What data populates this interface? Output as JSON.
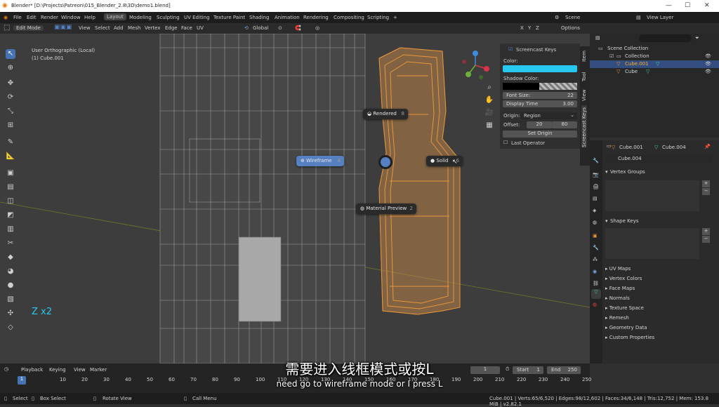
{
  "window": {
    "title": "Blender* [D:\\Projects\\Patreon\\015_Blender_2.8\\3D\\demo1.blend]"
  },
  "menu": {
    "items": [
      "File",
      "Edit",
      "Render",
      "Window",
      "Help"
    ]
  },
  "workspaces": [
    "Layout",
    "Modeling",
    "Sculpting",
    "UV Editing",
    "Texture Paint",
    "Shading",
    "Animation",
    "Rendering",
    "Compositing",
    "Scripting"
  ],
  "workspace_plus": "+",
  "scene_label": "Scene",
  "viewlayer_label": "View Layer",
  "header": {
    "mode": "Edit Mode",
    "items": [
      "View",
      "Select",
      "Add",
      "Mesh",
      "Vertex",
      "Edge",
      "Face",
      "UV"
    ],
    "orientation": "Global",
    "options": "Options",
    "axes": [
      "X",
      "Y",
      "Z"
    ]
  },
  "viewport": {
    "view_name": "User Orthographic (Local)",
    "object_name": "(1) Cube.001",
    "key_display": "Z x2"
  },
  "pie": {
    "rendered": {
      "label": "Rendered",
      "num": "8"
    },
    "wireframe": {
      "label": "Wireframe",
      "num": "4"
    },
    "solid": {
      "label": "Solid",
      "num": "6"
    },
    "material": {
      "label": "Material Preview",
      "num": "2"
    }
  },
  "npanel": {
    "title": "Screencast Keys",
    "color_label": "Color:",
    "color_value": "#27c8f0",
    "shadow_label": "Shadow Color:",
    "font_size_label": "Font Size:",
    "font_size": "22",
    "display_time_label": "Display Time",
    "display_time": "3.00",
    "origin_label": "Origin:",
    "origin_value": "Region",
    "offset_label": "Offset:",
    "offset_x": "20",
    "offset_y": "80",
    "set_origin": "Set Origin",
    "last_operator": "Last Operator",
    "tabs": [
      "Item",
      "Tool",
      "View",
      "Screencast Keys"
    ]
  },
  "outliner": {
    "scene_collection": "Scene Collection",
    "collection": "Collection",
    "obj1": "Cube.001",
    "obj2": "Cube"
  },
  "properties": {
    "object": "Cube.001",
    "mesh": "Cube.004",
    "mesh_field": "Cube.004",
    "vertex_groups": "Vertex Groups",
    "shape_keys": "Shape Keys",
    "sections": [
      "UV Maps",
      "Vertex Colors",
      "Face Maps",
      "Normals",
      "Texture Space",
      "Remesh",
      "Geometry Data",
      "Custom Properties"
    ]
  },
  "timeline": {
    "menus": [
      "Playback",
      "Keying",
      "View",
      "Marker"
    ],
    "current": "1",
    "start_label": "Start",
    "start": "1",
    "end_label": "End",
    "end": "250",
    "ticks": [
      "1",
      "10",
      "20",
      "30",
      "40",
      "50",
      "60",
      "70",
      "80",
      "90",
      "100",
      "110",
      "120",
      "130",
      "140",
      "150",
      "160",
      "170",
      "180",
      "190",
      "200",
      "210",
      "220",
      "230",
      "240",
      "250"
    ]
  },
  "statusbar": {
    "select": "Select",
    "box_select": "Box Select",
    "rotate_view": "Rotate View",
    "call_menu": "Call Menu",
    "stats": "Cube.001 | Verts:65/6,520 | Edges:98/12,602 | Faces:34/6,148 | Tris:12,752 | Mem: 153.8 MiB | v2.82.1"
  },
  "subtitles": {
    "zh": "需要进入线框模式或按L",
    "en": "need go to wireframe mode or I press L"
  },
  "colors": {
    "accent": "#4772b3",
    "selected_orange": "#e8953a",
    "pie_selected": "#5680c2"
  }
}
